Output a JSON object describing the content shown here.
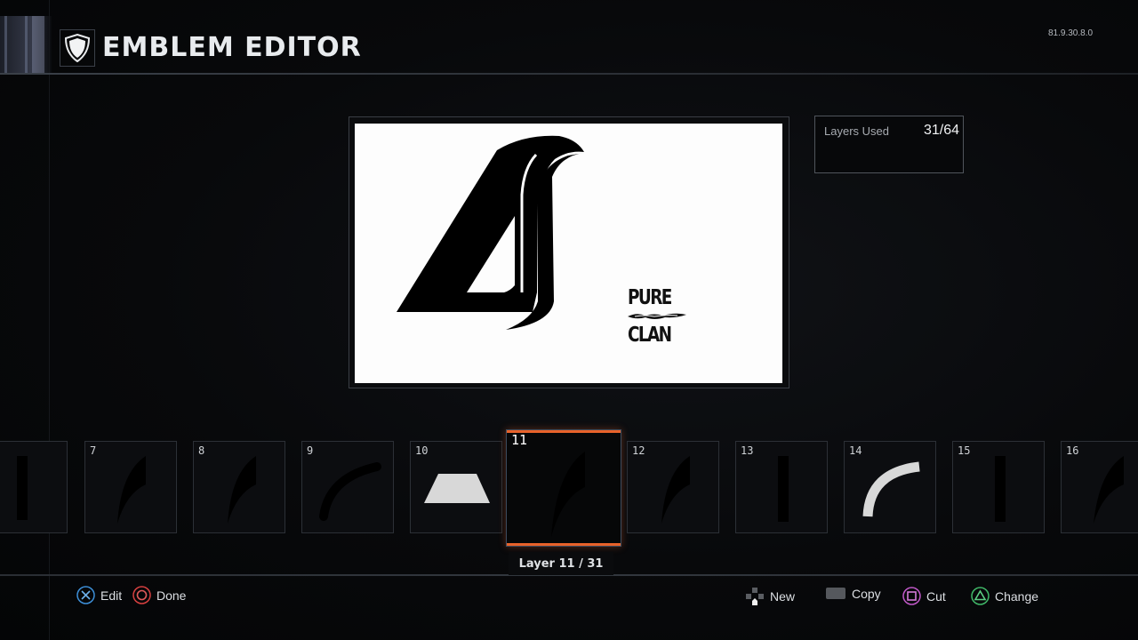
{
  "header": {
    "title": "EMBLEM EDITOR",
    "icon": "shield-icon",
    "version": "81.9.30.8.0"
  },
  "layers_used": {
    "label": "Layers Used",
    "value": "31/64"
  },
  "canvas": {
    "background_color": "#ffffff",
    "logo_icon": "stylized-4s-logo",
    "text_lines": [
      "PURE",
      "CLAN"
    ]
  },
  "layer_strip": {
    "tiles": [
      {
        "number": "",
        "shape": "vertical-bar",
        "color": "#000000"
      },
      {
        "number": "7",
        "shape": "claw",
        "color": "#000000"
      },
      {
        "number": "8",
        "shape": "claw",
        "color": "#000000"
      },
      {
        "number": "9",
        "shape": "arc",
        "color": "#000000"
      },
      {
        "number": "10",
        "shape": "trapezoid",
        "color": "#d8d8d8"
      },
      {
        "number": "11",
        "shape": "claw",
        "color": "#000000",
        "selected": true
      },
      {
        "number": "12",
        "shape": "claw",
        "color": "#000000"
      },
      {
        "number": "13",
        "shape": "vertical-bar",
        "color": "#000000"
      },
      {
        "number": "14",
        "shape": "arc",
        "color": "#d8d8d8"
      },
      {
        "number": "15",
        "shape": "vertical-bar",
        "color": "#000000"
      },
      {
        "number": "16",
        "shape": "claw",
        "color": "#000000"
      }
    ],
    "selected_label": "Layer 11 / 31",
    "selected_color": "#e8622a"
  },
  "footer": {
    "left": [
      {
        "button": "cross-button-icon",
        "label": "Edit",
        "color": "#3d8fd8"
      },
      {
        "button": "circle-button-icon",
        "label": "Done",
        "color": "#d84040"
      }
    ],
    "right": [
      {
        "button": "dpad-icon",
        "label": "New"
      },
      {
        "button": "touchpad-icon",
        "label": "Copy"
      },
      {
        "button": "square-button-icon",
        "label": "Cut",
        "color": "#c058c8"
      },
      {
        "button": "triangle-button-icon",
        "label": "Change",
        "color": "#40b868"
      }
    ]
  }
}
